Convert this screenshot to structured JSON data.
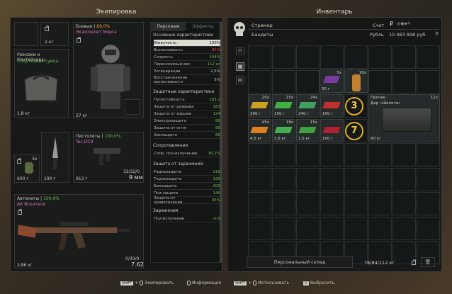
{
  "equipment": {
    "title": "Экипировка",
    "backpack": {
      "weight": "2 кг"
    },
    "combat": {
      "category": "Боевые",
      "percent": "89,0%",
      "name": "Экзоскелет Морга",
      "weight": "27 кг"
    },
    "bags": {
      "category": "Рюкзаки и Контейнеры",
      "name": "Спортивная сумка",
      "weight": "1,8 кг"
    },
    "knife": {
      "weight": "190 г"
    },
    "grenade": {
      "count": "3x",
      "weight": "600 г"
    },
    "pistol": {
      "category": "Пистолеты",
      "percent": "100,0%",
      "name": "Tec-DC9",
      "weight": "913 г",
      "ammo": "32/32/0",
      "caliber": "9 мм"
    },
    "rifle": {
      "category": "Автоматы",
      "percent": "100,0%",
      "name": "АК Искателя",
      "weight": "3,86 кг",
      "ammo": "0/30/0",
      "caliber": "7.62"
    }
  },
  "stats": {
    "tab_character": "Персонаж",
    "tab_effects": "Эффекты",
    "basic_title": "Основные характеристики",
    "basic": [
      {
        "label": "Живучесть",
        "value": "100%",
        "color": "#111111",
        "hl": true
      },
      {
        "label": "Выносливость",
        "value": "85%",
        "color": "#e04040"
      },
      {
        "label": "Скорость",
        "value": "104%",
        "color": "#6ec04a"
      },
      {
        "label": "Переносимый вес",
        "value": "112 кг",
        "color": "#6ec04a"
      },
      {
        "label": "Регенерация",
        "value": "2,5%",
        "color": "#c8c8c0"
      },
      {
        "label": "Восстановление выносливости",
        "value": "5%",
        "color": "#c8c8c0"
      }
    ],
    "protect_title": "Защитные характеристики",
    "protect": [
      {
        "label": "Пулестойкость",
        "value": "165,1"
      },
      {
        "label": "Защита от разрыва",
        "value": "163"
      },
      {
        "label": "Защита от взрыва",
        "value": "124"
      },
      {
        "label": "Электрозащита",
        "value": "80"
      },
      {
        "label": "Защита от огня",
        "value": "80"
      },
      {
        "label": "Химзащита",
        "value": "80"
      }
    ],
    "resist_title": "Сопротивления",
    "resist": [
      {
        "label": "Сопр. пси-излучению",
        "value": "16,2%"
      }
    ],
    "infect_title": "Защита от заражений",
    "infect": [
      {
        "label": "Радиозащита",
        "value": "210"
      },
      {
        "label": "Термозащита",
        "value": "120"
      },
      {
        "label": "Биозащита",
        "value": "200"
      },
      {
        "label": "Пси-защита",
        "value": "140"
      },
      {
        "label": "Защита от кровотечения",
        "value": "45%"
      }
    ],
    "contam_title": "Заражения",
    "contam": [
      {
        "label": "Пси-излучение",
        "value": "-0,9"
      }
    ]
  },
  "inventory": {
    "title": "Инвентарь",
    "player": "Стример",
    "faction": "Бандиты",
    "account_label": "Счет",
    "currency_label": "Рубль",
    "money": "10 463 998 руб.",
    "storage_button": "Персональный склад",
    "weight": "76/84/112 кг",
    "items": {
      "a1_count": "5x",
      "a1_weight": "50 г",
      "a2_count": "16x",
      "b1_count": "20x",
      "b1_weight": "200 г",
      "b2_count": "15x",
      "b2_weight": "150 г",
      "b3_count": "24x",
      "b3_weight": "240 г",
      "b4_weight": "100 г",
      "c1_count": "45x",
      "c1_weight": "4,5 кг",
      "c2_count": "18x",
      "c2_weight": "1,8 кг",
      "c3_count": "15x",
      "c3_weight": "1,5 кг",
      "c4_weight": "100 г",
      "badge1": "3",
      "badge2": "7",
      "crate_category": "Прочее",
      "crate_count": "12x",
      "crate_name": "Дар «Шепота»",
      "crate_weight": "60 кг"
    }
  },
  "footer": {
    "shift": "SHIFT",
    "equip": "Экипировать",
    "info": "Информация",
    "use": "Использовать",
    "drop": "Выбросить",
    "g_key": "G"
  }
}
